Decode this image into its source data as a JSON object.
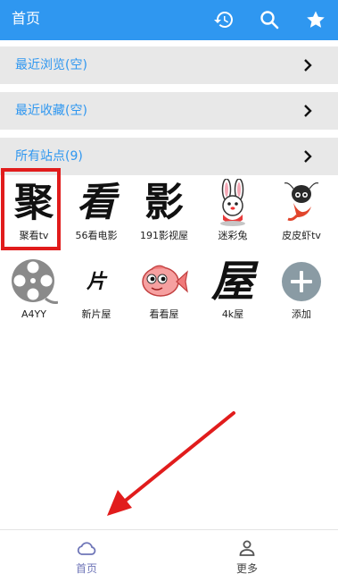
{
  "header": {
    "title": "首页",
    "icons": [
      "history-icon",
      "search-icon",
      "star-icon"
    ],
    "background": "#2f97f0"
  },
  "rows": [
    {
      "label": "最近浏览(空)"
    },
    {
      "label": "最近收藏(空)"
    },
    {
      "label": "所有站点(9)"
    }
  ],
  "sites": [
    {
      "name": "聚看tv",
      "glyph": "聚"
    },
    {
      "name": "56看电影",
      "glyph": "看"
    },
    {
      "name": "191影视屋",
      "glyph": "影"
    },
    {
      "name": "迷彩兔",
      "icon": "rabbit-icon"
    },
    {
      "name": "皮皮虾tv",
      "icon": "shrimp-icon"
    },
    {
      "name": "A4YY",
      "icon": "film-reel-icon"
    },
    {
      "name": "新片屋",
      "glyph": "片"
    },
    {
      "name": "看看屋",
      "icon": "fish-icon"
    },
    {
      "name": "4k屋",
      "glyph": "屋"
    },
    {
      "name": "添加",
      "icon": "add-icon"
    }
  ],
  "bottom_nav": [
    {
      "label": "首页",
      "icon": "cloud-icon",
      "color": "#6f76b8",
      "active": true
    },
    {
      "label": "更多",
      "icon": "person-icon",
      "color": "#555555",
      "active": false
    }
  ],
  "accent": "#2f97f0",
  "highlight_color": "#e11c1c"
}
